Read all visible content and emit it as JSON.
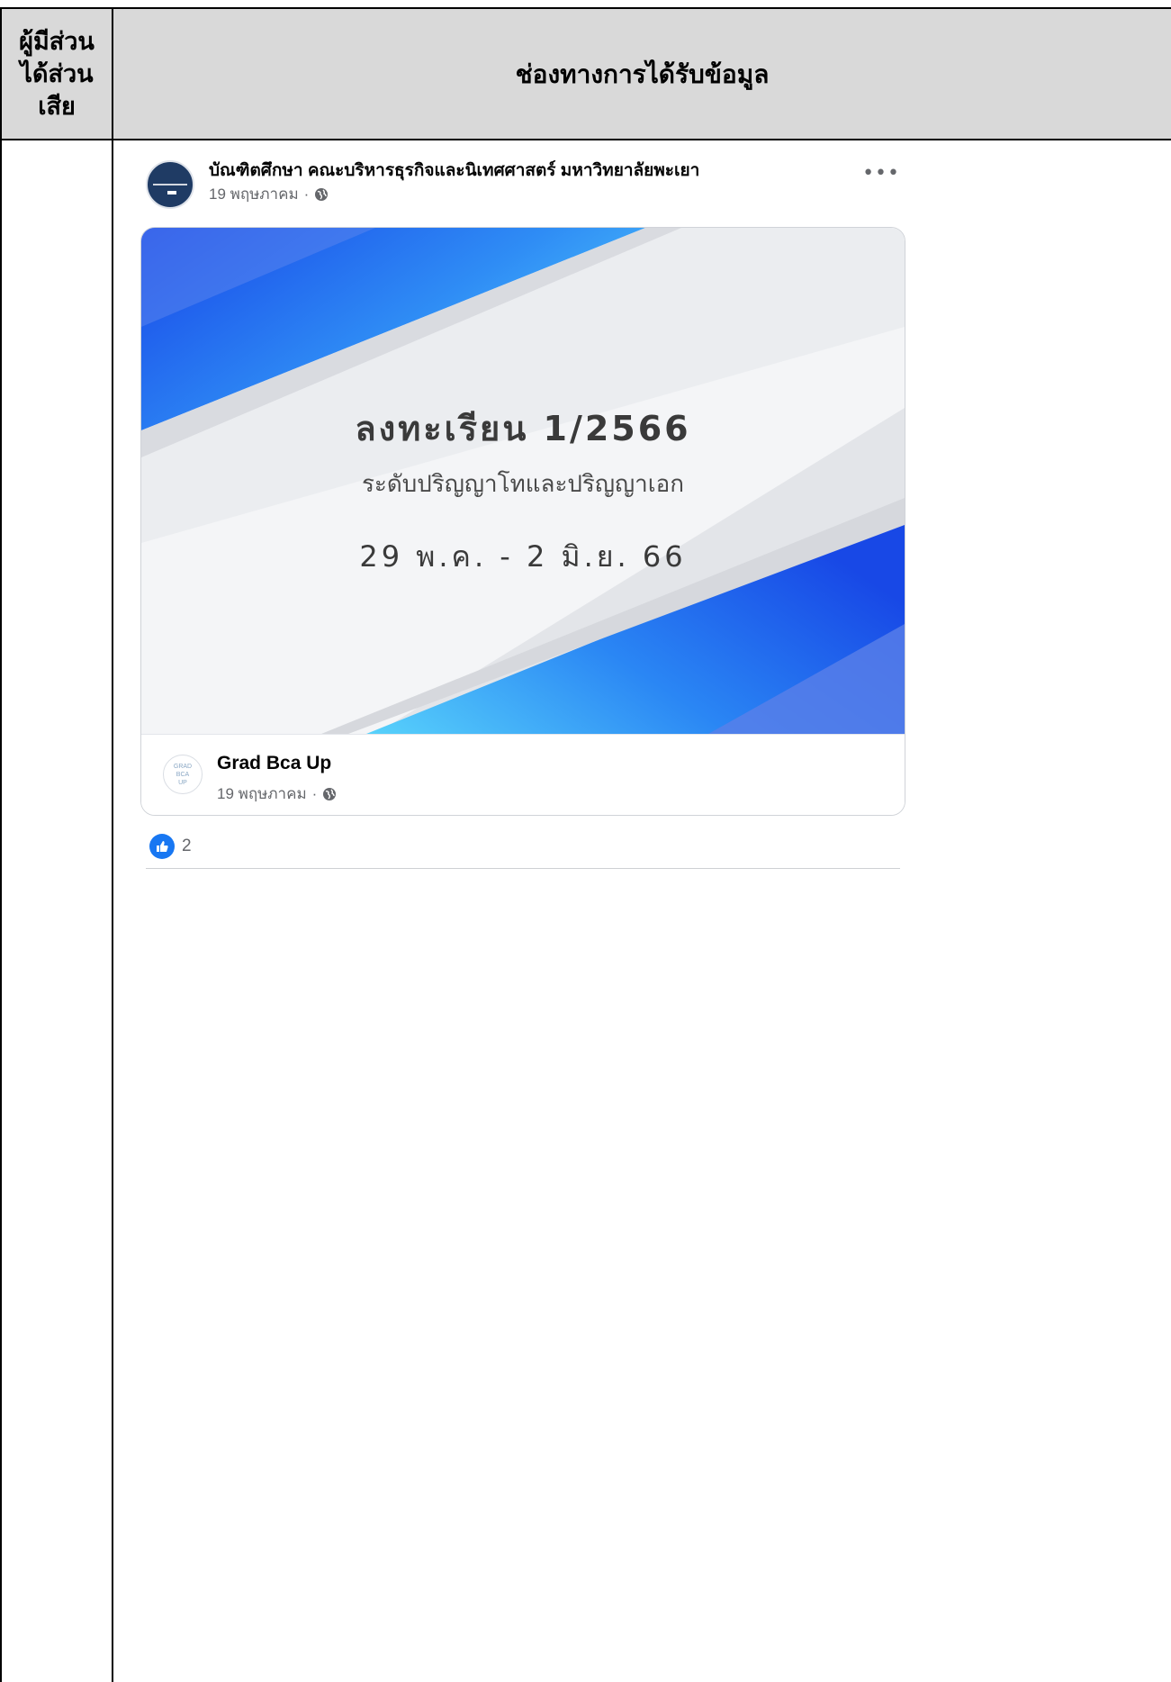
{
  "table": {
    "header_col1": "ผู้มีส่วน\nได้ส่วน\nเสีย",
    "header_col2": "ช่องทางการได้รับข้อมูล"
  },
  "post": {
    "page_name": "บัณฑิตศึกษา คณะบริหารธุรกิจและนิเทศศาสตร์ มหาวิทยาลัยพะเยา",
    "date": "19 พฤษภาคม",
    "more_label": "•••",
    "banner": {
      "title": "ลงทะเรียน 1/2566",
      "subtitle": "ระดับปริญญาโทและปริญญาเอก",
      "dates": "29 พ.ค. - 2 มิ.ย. 66"
    },
    "shared_page": {
      "avatar_text": "GRAD\nBCA\nUP",
      "name": "Grad Bca Up",
      "date": "19 พฤษภาคม"
    },
    "like_count": "2"
  },
  "colors": {
    "header_bg": "#d9d9d9",
    "accent_blue": "#1877f2",
    "banner_blue": "#1a5cf0"
  }
}
